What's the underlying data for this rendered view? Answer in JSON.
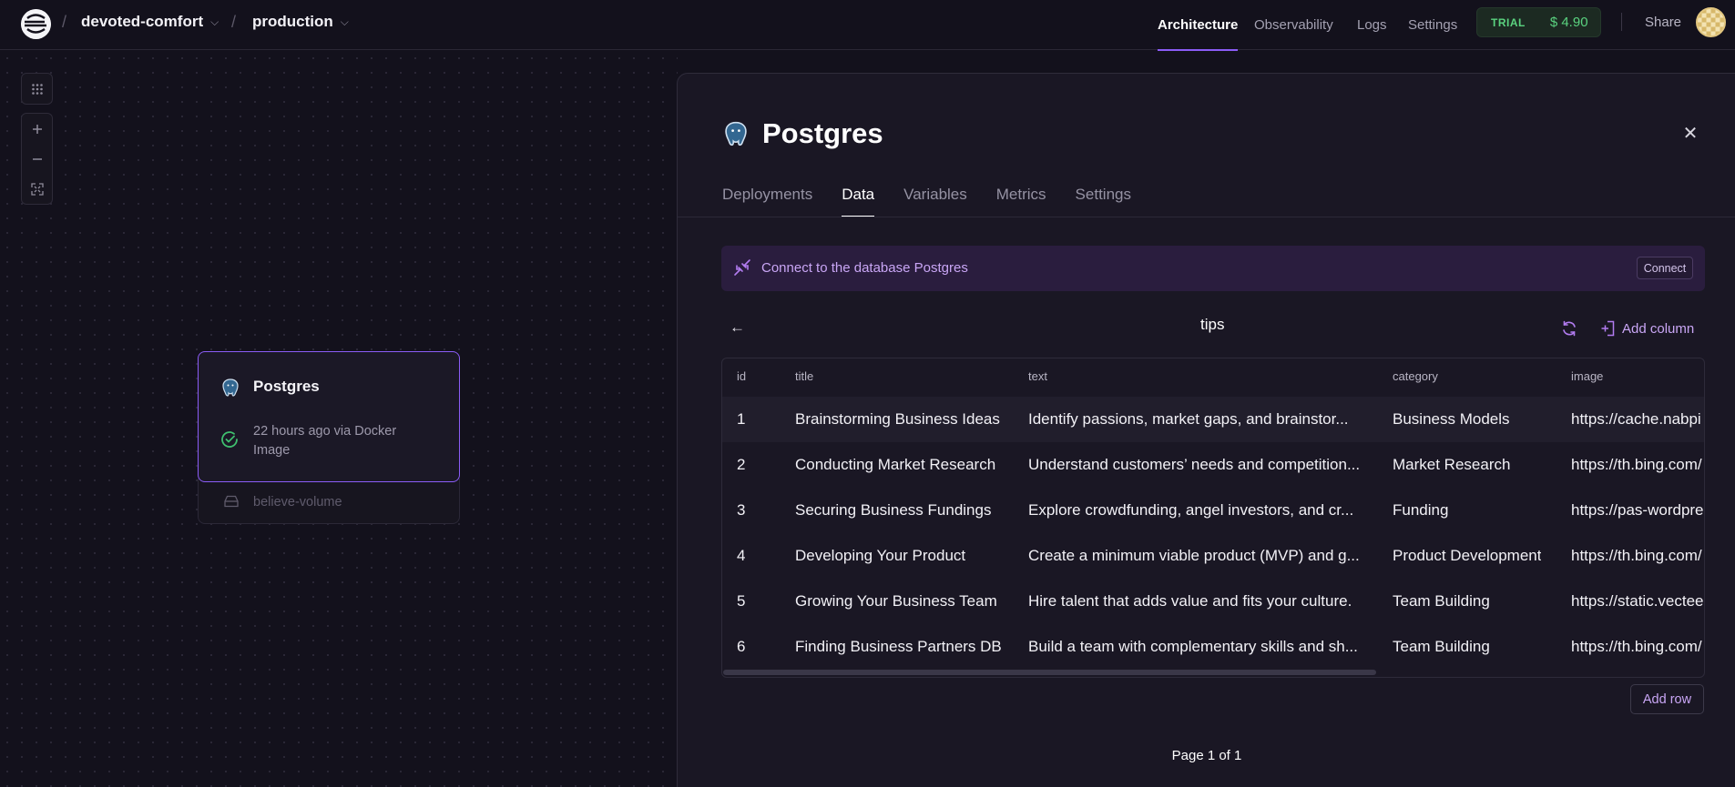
{
  "header": {
    "project": "devoted-comfort",
    "environment": "production",
    "nav": [
      "Architecture",
      "Observability",
      "Logs",
      "Settings"
    ],
    "active_nav": "Architecture",
    "trial_label": "TRIAL",
    "trial_credit": "$ 4.90",
    "share_label": "Share"
  },
  "canvas": {
    "controls": [
      "grid-icon",
      "zoom-in-icon",
      "zoom-out-icon",
      "fit-view-icon"
    ],
    "service": {
      "name": "Postgres",
      "status": "22 hours ago via Docker Image",
      "status_color": "#3fbf6f",
      "volume": "believe-volume"
    }
  },
  "panel": {
    "title": "Postgres",
    "tabs": [
      "Deployments",
      "Data",
      "Variables",
      "Metrics",
      "Settings"
    ],
    "active_tab": "Data",
    "connect_text": "Connect to the database Postgres",
    "connect_button": "Connect",
    "table_name": "tips",
    "add_column": "Add column",
    "columns": [
      "id",
      "title",
      "text",
      "category",
      "image"
    ],
    "rows": [
      [
        "1",
        "Brainstorming Business Ideas",
        "Identify passions, market gaps, and brainstor...",
        "Business Models",
        "https://cache.nabpi"
      ],
      [
        "2",
        "Conducting Market Research",
        "Understand customers’ needs and competition...",
        "Market Research",
        "https://th.bing.com/"
      ],
      [
        "3",
        "Securing Business Fundings",
        "Explore crowdfunding, angel investors, and cr...",
        "Funding",
        "https://pas-wordpre"
      ],
      [
        "4",
        "Developing Your Product",
        "Create a minimum viable product (MVP) and g...",
        "Product Development",
        "https://th.bing.com/"
      ],
      [
        "5",
        "Growing Your Business Team",
        "Hire talent that adds value and fits your culture.",
        "Team Building",
        "https://static.vectee"
      ],
      [
        "6",
        "Finding Business Partners DB",
        "Build a team with complementary skills and sh...",
        "Team Building",
        "https://th.bing.com/"
      ]
    ],
    "add_row": "Add row",
    "pagination": "Page 1 of 1"
  },
  "colors": {
    "background": "#13111c",
    "accent": "#8b5cf6",
    "trial_green": "#5ad27f",
    "connect_bg": "#2a1d3e"
  }
}
